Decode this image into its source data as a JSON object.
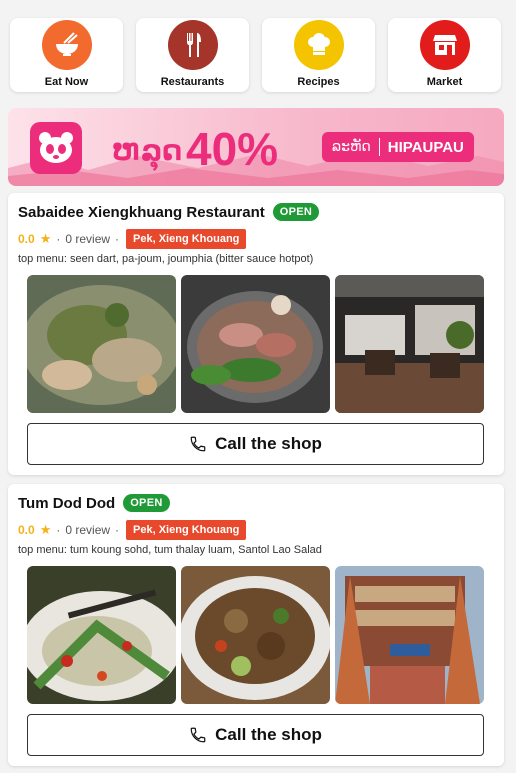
{
  "categories": [
    {
      "label": "Eat Now",
      "icon": "noodle-bowl-icon",
      "color": "#f26a2e"
    },
    {
      "label": "Restaurants",
      "icon": "fork-knife-icon",
      "color": "#a5352a"
    },
    {
      "label": "Recipes",
      "icon": "chef-hat-icon",
      "color": "#f5c400"
    },
    {
      "label": "Market",
      "icon": "storefront-icon",
      "color": "#e21b1b"
    }
  ],
  "banner": {
    "discount_lao": "ຫລຸດ",
    "percent": "40%",
    "code_label": "ລະຫັດ",
    "code": "HIPAUPAU",
    "logo": "foodpanda-logo",
    "accent": "#ec2d7b"
  },
  "listings": [
    {
      "name": "Sabaidee Xiengkhuang Restaurant",
      "status": "OPEN",
      "rating": "0.0",
      "reviews": "0 review",
      "location": "Pek, Xieng Khouang",
      "menu": "top menu: seen dart, pa-joum, joumphia (bitter sauce hotpot)",
      "call_label": "Call the shop"
    },
    {
      "name": "Tum Dod Dod",
      "status": "OPEN",
      "rating": "0.0",
      "reviews": "0 review",
      "location": "Pek, Xieng Khouang",
      "menu": "top menu: tum koung sohd, tum thalay luam, Santol Lao Salad",
      "call_label": "Call the shop"
    }
  ],
  "colors": {
    "open": "#1f9a37",
    "location": "#e8482b",
    "star": "#f2b21a"
  }
}
